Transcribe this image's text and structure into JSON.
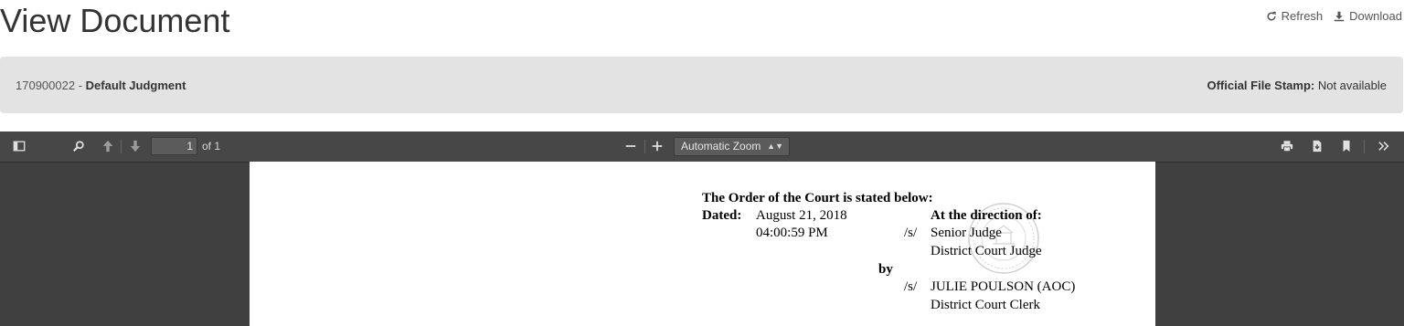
{
  "header": {
    "title": "View Document",
    "refresh_label": "Refresh",
    "download_label": "Download"
  },
  "info_bar": {
    "case_number": "170900022",
    "separator": " - ",
    "document_name": "Default Judgment",
    "stamp_label": "Official File Stamp:",
    "stamp_value": "Not available"
  },
  "viewer": {
    "toolbar": {
      "page_number": "1",
      "page_count_text": "of 1",
      "zoom_value": "Automatic Zoom",
      "icons": [
        "sidebar-toggle-icon",
        "search-icon",
        "arrow-up-icon",
        "arrow-down-icon",
        "zoom-out-icon",
        "zoom-in-icon",
        "print-icon",
        "download-icon",
        "bookmark-icon",
        "chevron-double-right-icon"
      ]
    },
    "document": {
      "heading": "The Order of the Court is stated below:",
      "dated_label": "Dated:",
      "date": "August 21, 2018",
      "time": "04:00:59 PM",
      "direction_heading": "At the direction of:",
      "sig1_mark": "/s/",
      "judge_name": "Senior Judge",
      "judge_title": "District Court Judge",
      "by_label": "by",
      "sig2_mark": "/s/",
      "clerk_name": "JULIE POULSON (AOC)",
      "clerk_title": "District Court Clerk"
    }
  }
}
